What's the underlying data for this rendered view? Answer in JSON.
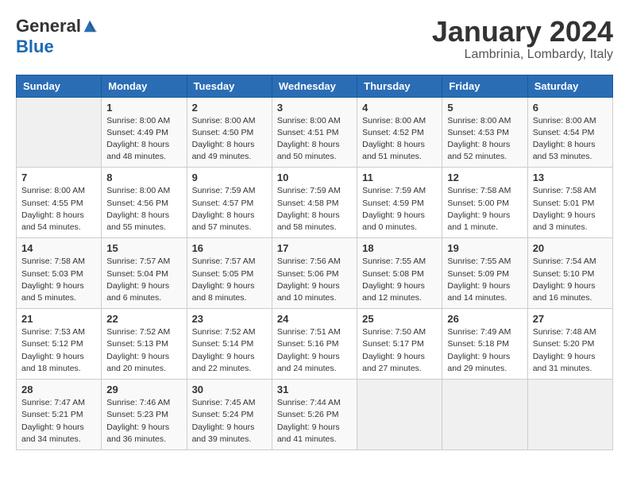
{
  "logo": {
    "general": "General",
    "blue": "Blue"
  },
  "title": "January 2024",
  "location": "Lambrinia, Lombardy, Italy",
  "days_of_week": [
    "Sunday",
    "Monday",
    "Tuesday",
    "Wednesday",
    "Thursday",
    "Friday",
    "Saturday"
  ],
  "weeks": [
    [
      {
        "day": "",
        "sunrise": "",
        "sunset": "",
        "daylight": ""
      },
      {
        "day": "1",
        "sunrise": "Sunrise: 8:00 AM",
        "sunset": "Sunset: 4:49 PM",
        "daylight": "Daylight: 8 hours and 48 minutes."
      },
      {
        "day": "2",
        "sunrise": "Sunrise: 8:00 AM",
        "sunset": "Sunset: 4:50 PM",
        "daylight": "Daylight: 8 hours and 49 minutes."
      },
      {
        "day": "3",
        "sunrise": "Sunrise: 8:00 AM",
        "sunset": "Sunset: 4:51 PM",
        "daylight": "Daylight: 8 hours and 50 minutes."
      },
      {
        "day": "4",
        "sunrise": "Sunrise: 8:00 AM",
        "sunset": "Sunset: 4:52 PM",
        "daylight": "Daylight: 8 hours and 51 minutes."
      },
      {
        "day": "5",
        "sunrise": "Sunrise: 8:00 AM",
        "sunset": "Sunset: 4:53 PM",
        "daylight": "Daylight: 8 hours and 52 minutes."
      },
      {
        "day": "6",
        "sunrise": "Sunrise: 8:00 AM",
        "sunset": "Sunset: 4:54 PM",
        "daylight": "Daylight: 8 hours and 53 minutes."
      }
    ],
    [
      {
        "day": "7",
        "sunrise": "Sunrise: 8:00 AM",
        "sunset": "Sunset: 4:55 PM",
        "daylight": "Daylight: 8 hours and 54 minutes."
      },
      {
        "day": "8",
        "sunrise": "Sunrise: 8:00 AM",
        "sunset": "Sunset: 4:56 PM",
        "daylight": "Daylight: 8 hours and 55 minutes."
      },
      {
        "day": "9",
        "sunrise": "Sunrise: 7:59 AM",
        "sunset": "Sunset: 4:57 PM",
        "daylight": "Daylight: 8 hours and 57 minutes."
      },
      {
        "day": "10",
        "sunrise": "Sunrise: 7:59 AM",
        "sunset": "Sunset: 4:58 PM",
        "daylight": "Daylight: 8 hours and 58 minutes."
      },
      {
        "day": "11",
        "sunrise": "Sunrise: 7:59 AM",
        "sunset": "Sunset: 4:59 PM",
        "daylight": "Daylight: 9 hours and 0 minutes."
      },
      {
        "day": "12",
        "sunrise": "Sunrise: 7:58 AM",
        "sunset": "Sunset: 5:00 PM",
        "daylight": "Daylight: 9 hours and 1 minute."
      },
      {
        "day": "13",
        "sunrise": "Sunrise: 7:58 AM",
        "sunset": "Sunset: 5:01 PM",
        "daylight": "Daylight: 9 hours and 3 minutes."
      }
    ],
    [
      {
        "day": "14",
        "sunrise": "Sunrise: 7:58 AM",
        "sunset": "Sunset: 5:03 PM",
        "daylight": "Daylight: 9 hours and 5 minutes."
      },
      {
        "day": "15",
        "sunrise": "Sunrise: 7:57 AM",
        "sunset": "Sunset: 5:04 PM",
        "daylight": "Daylight: 9 hours and 6 minutes."
      },
      {
        "day": "16",
        "sunrise": "Sunrise: 7:57 AM",
        "sunset": "Sunset: 5:05 PM",
        "daylight": "Daylight: 9 hours and 8 minutes."
      },
      {
        "day": "17",
        "sunrise": "Sunrise: 7:56 AM",
        "sunset": "Sunset: 5:06 PM",
        "daylight": "Daylight: 9 hours and 10 minutes."
      },
      {
        "day": "18",
        "sunrise": "Sunrise: 7:55 AM",
        "sunset": "Sunset: 5:08 PM",
        "daylight": "Daylight: 9 hours and 12 minutes."
      },
      {
        "day": "19",
        "sunrise": "Sunrise: 7:55 AM",
        "sunset": "Sunset: 5:09 PM",
        "daylight": "Daylight: 9 hours and 14 minutes."
      },
      {
        "day": "20",
        "sunrise": "Sunrise: 7:54 AM",
        "sunset": "Sunset: 5:10 PM",
        "daylight": "Daylight: 9 hours and 16 minutes."
      }
    ],
    [
      {
        "day": "21",
        "sunrise": "Sunrise: 7:53 AM",
        "sunset": "Sunset: 5:12 PM",
        "daylight": "Daylight: 9 hours and 18 minutes."
      },
      {
        "day": "22",
        "sunrise": "Sunrise: 7:52 AM",
        "sunset": "Sunset: 5:13 PM",
        "daylight": "Daylight: 9 hours and 20 minutes."
      },
      {
        "day": "23",
        "sunrise": "Sunrise: 7:52 AM",
        "sunset": "Sunset: 5:14 PM",
        "daylight": "Daylight: 9 hours and 22 minutes."
      },
      {
        "day": "24",
        "sunrise": "Sunrise: 7:51 AM",
        "sunset": "Sunset: 5:16 PM",
        "daylight": "Daylight: 9 hours and 24 minutes."
      },
      {
        "day": "25",
        "sunrise": "Sunrise: 7:50 AM",
        "sunset": "Sunset: 5:17 PM",
        "daylight": "Daylight: 9 hours and 27 minutes."
      },
      {
        "day": "26",
        "sunrise": "Sunrise: 7:49 AM",
        "sunset": "Sunset: 5:18 PM",
        "daylight": "Daylight: 9 hours and 29 minutes."
      },
      {
        "day": "27",
        "sunrise": "Sunrise: 7:48 AM",
        "sunset": "Sunset: 5:20 PM",
        "daylight": "Daylight: 9 hours and 31 minutes."
      }
    ],
    [
      {
        "day": "28",
        "sunrise": "Sunrise: 7:47 AM",
        "sunset": "Sunset: 5:21 PM",
        "daylight": "Daylight: 9 hours and 34 minutes."
      },
      {
        "day": "29",
        "sunrise": "Sunrise: 7:46 AM",
        "sunset": "Sunset: 5:23 PM",
        "daylight": "Daylight: 9 hours and 36 minutes."
      },
      {
        "day": "30",
        "sunrise": "Sunrise: 7:45 AM",
        "sunset": "Sunset: 5:24 PM",
        "daylight": "Daylight: 9 hours and 39 minutes."
      },
      {
        "day": "31",
        "sunrise": "Sunrise: 7:44 AM",
        "sunset": "Sunset: 5:26 PM",
        "daylight": "Daylight: 9 hours and 41 minutes."
      },
      {
        "day": "",
        "sunrise": "",
        "sunset": "",
        "daylight": ""
      },
      {
        "day": "",
        "sunrise": "",
        "sunset": "",
        "daylight": ""
      },
      {
        "day": "",
        "sunrise": "",
        "sunset": "",
        "daylight": ""
      }
    ]
  ]
}
